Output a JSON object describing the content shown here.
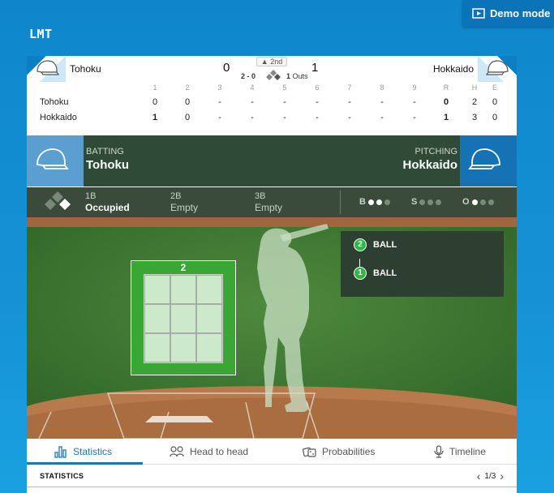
{
  "demo_button": {
    "label": "Demo mode"
  },
  "app_title": "LMT",
  "scoreboard": {
    "home_team": "Tohoku",
    "away_team": "Hokkaido",
    "home_score": "0",
    "away_score": "1",
    "inning": "▲ 2nd",
    "count": "2 - 0",
    "outs_value": "1",
    "outs_label": "Outs"
  },
  "linescore": {
    "headers": [
      "1",
      "2",
      "3",
      "4",
      "5",
      "6",
      "7",
      "8",
      "9",
      "R",
      "H",
      "E"
    ],
    "rows": [
      {
        "team": "Tohoku",
        "values": [
          "0",
          "0",
          "-",
          "-",
          "-",
          "-",
          "-",
          "-",
          "-",
          "0",
          "2",
          "0"
        ]
      },
      {
        "team": "Hokkaido",
        "values": [
          "1",
          "0",
          "-",
          "-",
          "-",
          "-",
          "-",
          "-",
          "-",
          "1",
          "3",
          "0"
        ]
      }
    ]
  },
  "batting": {
    "label": "BATTING",
    "team": "Tohoku"
  },
  "pitching": {
    "label": "PITCHING",
    "team": "Hokkaido"
  },
  "bases": [
    {
      "name": "1B",
      "status": "Occupied"
    },
    {
      "name": "2B",
      "status": "Empty"
    },
    {
      "name": "3B",
      "status": "Empty"
    }
  ],
  "count_indicators": {
    "balls": {
      "label": "B",
      "on": 2,
      "total": 3
    },
    "strikes": {
      "label": "S",
      "on": 0,
      "total": 3
    },
    "outs": {
      "label": "O",
      "on": 1,
      "total": 3
    }
  },
  "strike_zone": {
    "pitch_number": "2"
  },
  "pitches": [
    {
      "num": "2",
      "label": "BALL"
    },
    {
      "num": "1",
      "label": "BALL"
    }
  ],
  "tabs": [
    {
      "label": "Statistics",
      "icon": "bar-chart-icon",
      "active": true
    },
    {
      "label": "Head to head",
      "icon": "players-icon",
      "active": false
    },
    {
      "label": "Probabilities",
      "icon": "dice-icon",
      "active": false
    },
    {
      "label": "Timeline",
      "icon": "microphone-icon",
      "active": false
    }
  ],
  "statistics": {
    "label": "STATISTICS",
    "page": "1/3"
  },
  "colors": {
    "accent": "#1677bd",
    "field": "#3f7a33",
    "panel": "#2f4a36",
    "ball": "#2fb84a"
  }
}
